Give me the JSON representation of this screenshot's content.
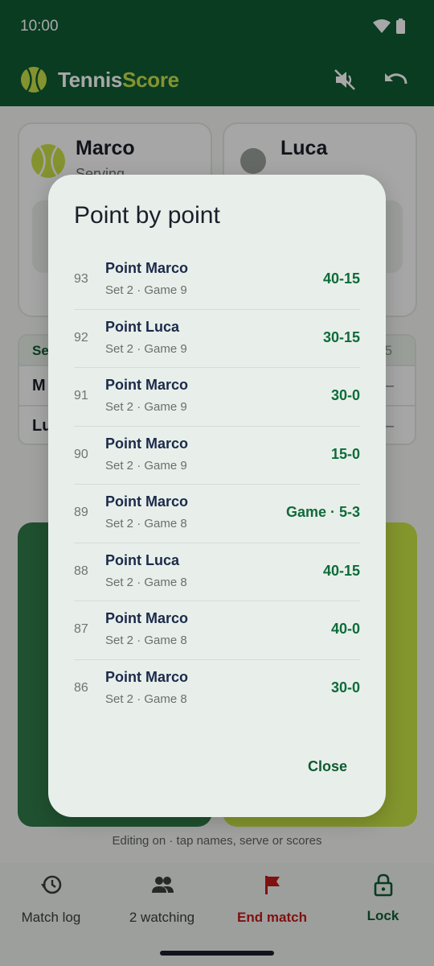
{
  "status_bar": {
    "time": "10:00"
  },
  "app_bar": {
    "brand_part1": "Tennis",
    "brand_part2": "Score"
  },
  "players": [
    {
      "name": "Marco",
      "status": "Serving"
    },
    {
      "name": "Luca"
    }
  ],
  "sets_card": {
    "header": "Se",
    "header_right": "5",
    "rows": [
      {
        "label": "M",
        "value": "–"
      },
      {
        "label": "Lu",
        "value": "–"
      }
    ]
  },
  "hint": "Editing on · tap names, serve or scores",
  "bottom_nav": {
    "items": [
      {
        "label": "Match log",
        "icon": "history-icon"
      },
      {
        "label": "2 watching",
        "icon": "people-icon"
      },
      {
        "label": "End match",
        "icon": "flag-icon"
      },
      {
        "label": "Lock",
        "icon": "lock-icon"
      }
    ]
  },
  "dialog": {
    "title": "Point by point",
    "close_label": "Close",
    "points": [
      {
        "num": "93",
        "name": "Point Marco",
        "detail": "Set 2 · Game 9",
        "score": "40-15"
      },
      {
        "num": "92",
        "name": "Point Luca",
        "detail": "Set 2 · Game 9",
        "score": "30-15"
      },
      {
        "num": "91",
        "name": "Point Marco",
        "detail": "Set 2 · Game 9",
        "score": "30-0"
      },
      {
        "num": "90",
        "name": "Point Marco",
        "detail": "Set 2 · Game 9",
        "score": "15-0"
      },
      {
        "num": "89",
        "name": "Point Marco",
        "detail": "Set 2 · Game 8",
        "score": "Game · 5-3"
      },
      {
        "num": "88",
        "name": "Point Luca",
        "detail": "Set 2 · Game 8",
        "score": "40-15"
      },
      {
        "num": "87",
        "name": "Point Marco",
        "detail": "Set 2 · Game 8",
        "score": "40-0"
      },
      {
        "num": "86",
        "name": "Point Marco",
        "detail": "Set 2 · Game 8",
        "score": "30-0"
      }
    ]
  },
  "colors": {
    "primary": "#0f5b33",
    "accent": "#c8e04a",
    "danger": "#c11a1a",
    "score_green": "#0f6b3a"
  }
}
